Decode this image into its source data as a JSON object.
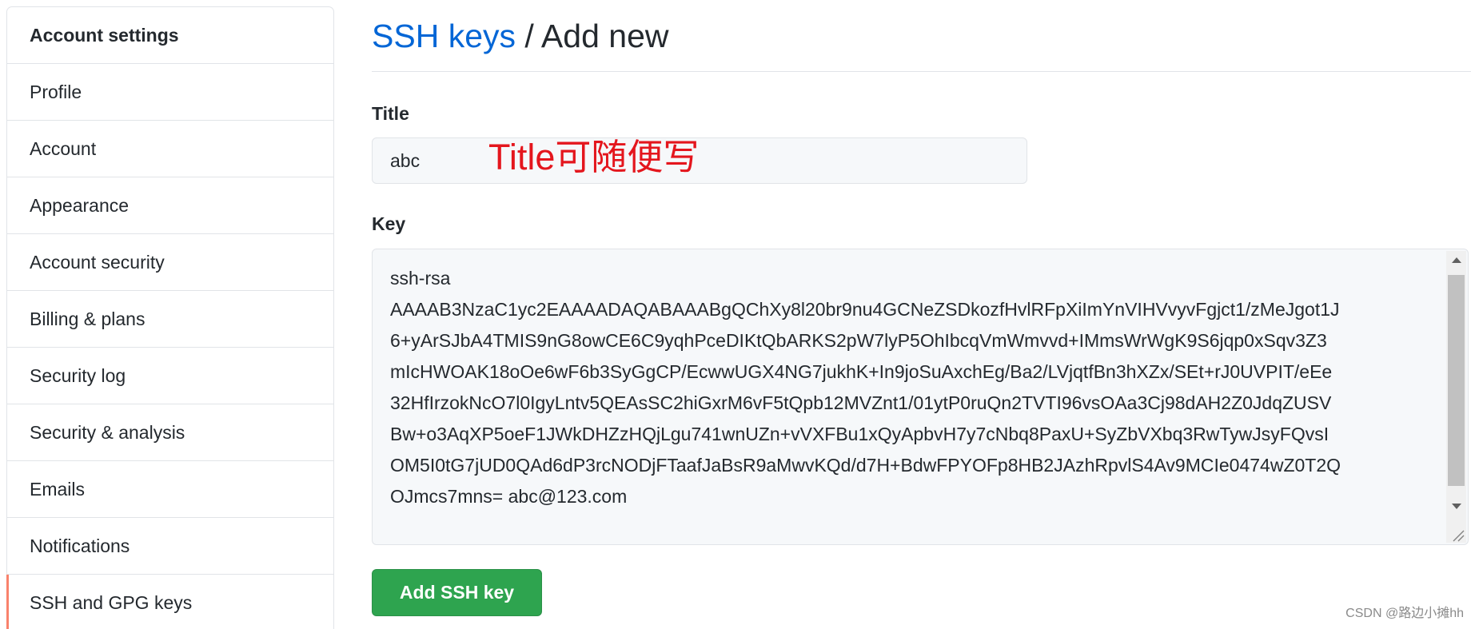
{
  "sidebar": {
    "heading": "Account settings",
    "items": [
      {
        "label": "Profile",
        "selected": false
      },
      {
        "label": "Account",
        "selected": false
      },
      {
        "label": "Appearance",
        "selected": false
      },
      {
        "label": "Account security",
        "selected": false
      },
      {
        "label": "Billing & plans",
        "selected": false
      },
      {
        "label": "Security log",
        "selected": false
      },
      {
        "label": "Security & analysis",
        "selected": false
      },
      {
        "label": "Emails",
        "selected": false
      },
      {
        "label": "Notifications",
        "selected": false
      },
      {
        "label": "SSH and GPG keys",
        "selected": true
      }
    ]
  },
  "page": {
    "breadcrumb_link": "SSH keys",
    "breadcrumb_separator": " / ",
    "title": "Add new"
  },
  "form": {
    "title_label": "Title",
    "title_value": "abc",
    "key_label": "Key",
    "key_value": "ssh-rsa\nAAAAB3NzaC1yc2EAAAADAQABAAABgQChXy8l20br9nu4GCNeZSDkozfHvlRFpXiImYnVIHVvyvFgjct1/zMeJgot1J\n6+yArSJbA4TMIS9nG8owCE6C9yqhPceDIKtQbARKS2pW7lyP5OhIbcqVmWmvvd+IMmsWrWgK9S6jqp0xSqv3Z3\nmIcHWOAK18oOe6wF6b3SyGgCP/EcwwUGX4NG7jukhK+In9joSuAxchEg/Ba2/LVjqtfBn3hXZx/SEt+rJ0UVPIT/eEe\n32HfIrzokNcO7l0IgyLntv5QEAsSC2hiGxrM6vF5tQpb12MVZnt1/01ytP0ruQn2TVTI96vsOAa3Cj98dAH2Z0JdqZUSV\nBw+o3AqXP5oeF1JWkDHZzHQjLgu741wnUZn+vVXFBu1xQyApbvH7y7cNbq8PaxU+SyZbVXbq3RwTywJsyFQvsI\nOM5I0tG7jUD0QAd6dP3rcNODjFTaafJaBsR9aMwvKQd/d7H+BdwFPYOFp8HB2JAzhRpvlS4Av9MCIe0474wZ0T2Q\nOJmcs7mns= abc@123.com",
    "submit_label": "Add SSH key"
  },
  "annotation": {
    "text": "Title可随便写"
  },
  "watermark": {
    "text": "CSDN @路边小摊hh"
  },
  "icons": {
    "scroll_up": "scroll-up-arrow-icon",
    "scroll_down": "scroll-down-arrow-icon",
    "resize": "resize-grip-icon"
  },
  "colors": {
    "text": "#24292e",
    "link": "#0366d6",
    "border": "#e1e4e8",
    "field_bg": "#f6f8fa",
    "primary": "#2ea44f",
    "selected": "#f9826c",
    "annotation": "#e4161d",
    "watermark": "#8a8a8a"
  }
}
